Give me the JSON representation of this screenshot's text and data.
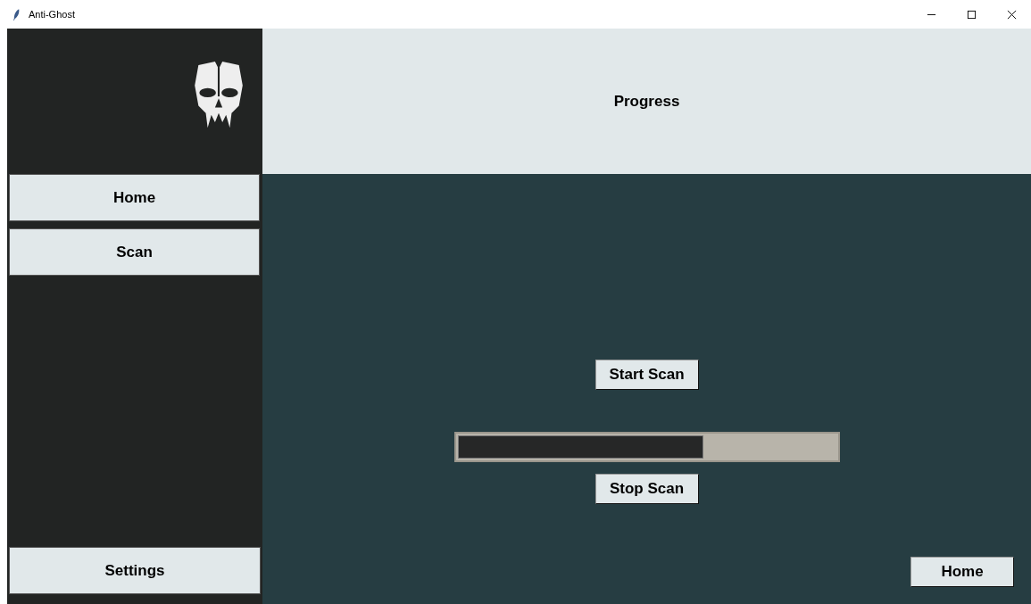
{
  "window": {
    "title": "Anti-Ghost"
  },
  "sidebar": {
    "items": [
      {
        "label": "Home"
      },
      {
        "label": "Scan"
      }
    ],
    "bottom_item": {
      "label": "Settings"
    }
  },
  "header": {
    "title": "Progress"
  },
  "main": {
    "start_button": "Start Scan",
    "progress": {
      "level": 0.65
    },
    "stop_button": "Stop Scan",
    "home_button": "Home"
  }
}
